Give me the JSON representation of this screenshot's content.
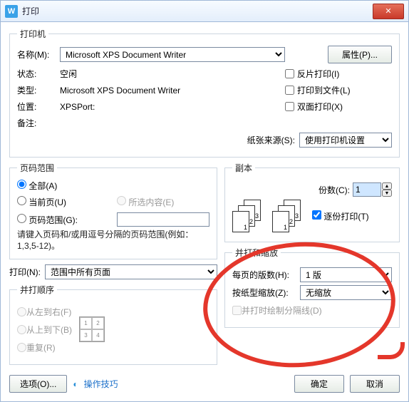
{
  "window": {
    "title": "打印",
    "app_icon": "W"
  },
  "printer": {
    "legend": "打印机",
    "name_label": "名称(M):",
    "name_value": "Microsoft XPS Document Writer",
    "properties_btn": "属性(P)...",
    "status_label": "状态:",
    "status_value": "空闲",
    "type_label": "类型:",
    "type_value": "Microsoft XPS Document Writer",
    "where_label": "位置:",
    "where_value": "XPSPort:",
    "comment_label": "备注:",
    "reverse_cb": "反片打印(I)",
    "tofile_cb": "打印到文件(L)",
    "duplex_cb": "双面打印(X)",
    "papersrc_label": "纸张来源(S):",
    "papersrc_value": "使用打印机设置"
  },
  "range": {
    "legend": "页码范围",
    "all": "全部(A)",
    "current": "当前页(U)",
    "selection": "所选内容(E)",
    "pages": "页码范围(G):",
    "pages_value": "",
    "hint": "请键入页码和/或用逗号分隔的页码范围(例如：1,3,5-12)。",
    "print_label": "打印(N):",
    "print_value": "范围中所有页面"
  },
  "copies": {
    "legend": "副本",
    "count_label": "份数(C):",
    "count_value": "1",
    "collate": "逐份打印(T)"
  },
  "order": {
    "legend": "并打顺序",
    "lr": "从左到右(F)",
    "tb": "从上到下(B)",
    "repeat": "重复(R)",
    "cells": [
      "1",
      "2",
      "3",
      "4"
    ]
  },
  "zoom": {
    "legend": "并打和缩放",
    "pps_label": "每页的版数(H):",
    "pps_value": "1 版",
    "scale_label": "按纸型缩放(Z):",
    "scale_value": "无缩放",
    "sep_cb": "并打时绘制分隔线(D)"
  },
  "footer": {
    "options": "选项(O)...",
    "tips": "操作技巧",
    "ok": "确定",
    "cancel": "取消"
  }
}
